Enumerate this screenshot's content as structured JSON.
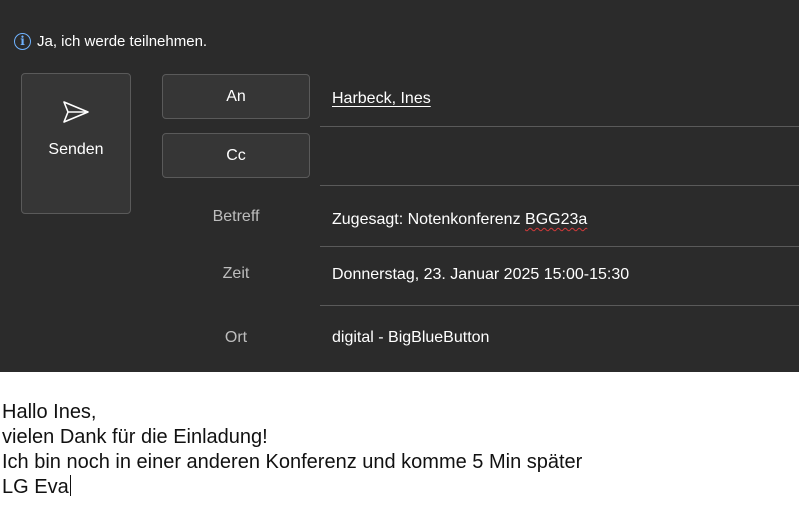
{
  "info_bar": {
    "icon": "info-circle-icon",
    "text": "Ja, ich werde teilnehmen."
  },
  "send": {
    "label": "Senden",
    "icon": "send-arrow-icon"
  },
  "recipients": {
    "to_label": "An",
    "to_value": "Harbeck, Ines",
    "cc_label": "Cc",
    "cc_value": ""
  },
  "meeting": {
    "subject_label": "Betreff",
    "subject_prefix": "Zugesagt: Notenkonferenz ",
    "subject_flagged": "BGG23a",
    "time_label": "Zeit",
    "time_value": "Donnerstag, 23. Januar 2025 15:00-15:30",
    "location_label": "Ort",
    "location_value": "digital - BigBlueButton"
  },
  "body": {
    "lines": [
      "Hallo Ines,",
      "vielen Dank für die Einladung!",
      "Ich bin noch in einer anderen Konferenz und komme 5 Min später",
      "LG Eva"
    ]
  },
  "colors": {
    "header_bg": "#2b2b2b",
    "button_bg": "#363636",
    "info_icon": "#6fb3ff",
    "spell_underline": "#d33a3a"
  }
}
